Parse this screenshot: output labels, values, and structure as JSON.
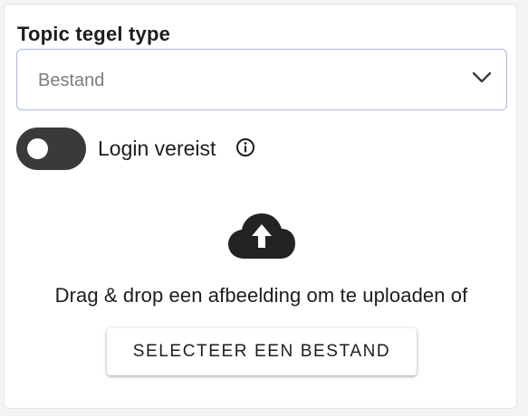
{
  "form": {
    "tile_type_label": "Topic tegel type",
    "tile_type_value": "Bestand",
    "login_toggle": {
      "label": "Login vereist",
      "checked": false
    },
    "upload": {
      "instruction": "Drag & drop een afbeelding om te uploaden of",
      "button_label": "SELECTEER EEN BESTAND"
    }
  },
  "icons": {
    "select_arrow": "chevron-down-icon",
    "info": "info-icon",
    "upload": "cloud-upload-icon"
  },
  "colors": {
    "select_border": "#aab7e6",
    "toggle_track": "#3a3a3d",
    "text": "#1d1d1f",
    "placeholder": "#7d7d82"
  }
}
